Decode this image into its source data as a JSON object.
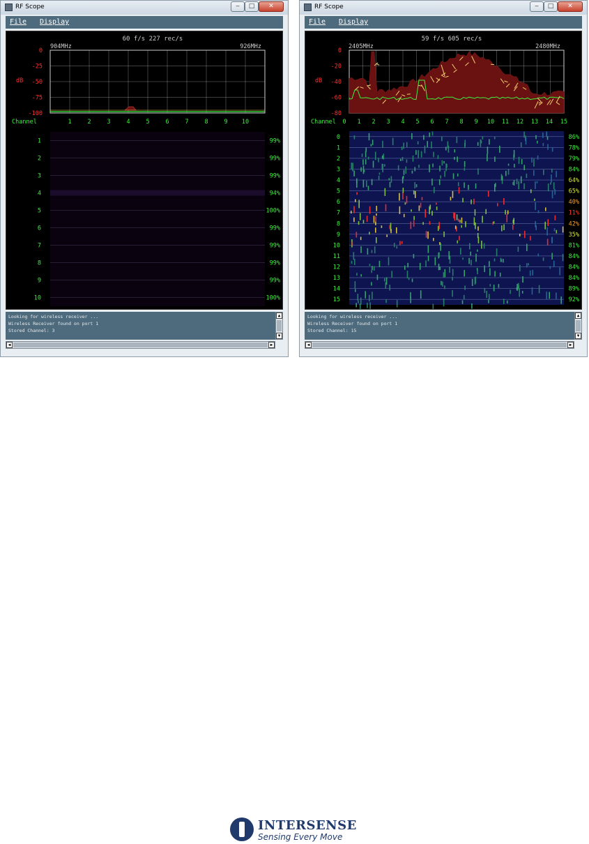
{
  "windows": [
    {
      "id": "left",
      "title": "RF Scope",
      "controls": {
        "minimize": "‒",
        "maximize": "□",
        "close": "✕"
      },
      "menu": [
        {
          "label": "File"
        },
        {
          "label": "Display"
        }
      ],
      "spectrum": {
        "rate": "60 f/s 227 rec/s",
        "freq_start": "904MHz",
        "freq_end": "926MHz",
        "db_unit": "dB",
        "db_ticks": [
          "0",
          "-25",
          "-50",
          "-75",
          "-100"
        ],
        "channel_label": "Channel",
        "channels": [
          "1",
          "2",
          "3",
          "4",
          "5",
          "6",
          "7",
          "8",
          "9",
          "10"
        ]
      },
      "waterfall": {
        "rows": [
          "1",
          "2",
          "3",
          "4",
          "5",
          "6",
          "7",
          "8",
          "9",
          "10"
        ],
        "percents": [
          "99%",
          "99%",
          "99%",
          "94%",
          "100%",
          "99%",
          "99%",
          "99%",
          "99%",
          "100%"
        ],
        "percent_colors": [
          "#3ef03e",
          "#3ef03e",
          "#3ef03e",
          "#3ef03e",
          "#3ef03e",
          "#3ef03e",
          "#3ef03e",
          "#3ef03e",
          "#3ef03e",
          "#3ef03e"
        ]
      },
      "console": [
        "Looking for wireless receiver ...",
        "Wireless Receiver found on port 1",
        "Stored Channel: 3"
      ]
    },
    {
      "id": "right",
      "title": "RF Scope",
      "controls": {
        "minimize": "‒",
        "maximize": "□",
        "close": "✕"
      },
      "menu": [
        {
          "label": "File"
        },
        {
          "label": "Display"
        }
      ],
      "spectrum": {
        "rate": "59 f/s 605 rec/s",
        "freq_start": "2405MHz",
        "freq_end": "2480MHz",
        "db_unit": "dB",
        "db_ticks": [
          "0",
          "-20",
          "-40",
          "-60",
          "-80"
        ],
        "channel_label": "Channel",
        "channels": [
          "0",
          "1",
          "2",
          "3",
          "4",
          "5",
          "6",
          "7",
          "8",
          "9",
          "10",
          "11",
          "12",
          "13",
          "14",
          "15"
        ]
      },
      "waterfall": {
        "rows": [
          "0",
          "1",
          "2",
          "3",
          "4",
          "5",
          "6",
          "7",
          "8",
          "9",
          "10",
          "11",
          "12",
          "13",
          "14",
          "15"
        ],
        "percents": [
          "86%",
          "78%",
          "79%",
          "84%",
          "64%",
          "65%",
          "40%",
          "11%",
          "42%",
          "35%",
          "81%",
          "84%",
          "84%",
          "84%",
          "89%",
          "92%"
        ],
        "percent_colors": [
          "#3ef03e",
          "#3ef03e",
          "#3ef03e",
          "#3ef03e",
          "#d6e83a",
          "#d6e83a",
          "#f0a030",
          "#ff3a2a",
          "#f0a030",
          "#d6e83a",
          "#3ef03e",
          "#3ef03e",
          "#3ef03e",
          "#3ef03e",
          "#3ef03e",
          "#3ef03e"
        ]
      },
      "console": [
        "Looking for wireless receiver ...",
        "Wireless Receiver found on port 1",
        "Stored Channel: 15"
      ]
    }
  ],
  "colors": {
    "db_text": "#ff3030",
    "green_text": "#3ef03e",
    "grid": "#cfcfcf",
    "scope_bg": "#000000",
    "spectrum_fill": "#6a1212",
    "menu_bg": "#4e6b7d"
  },
  "logo": {
    "name": "INTERSENSE",
    "tagline": "Sensing Every Move"
  }
}
